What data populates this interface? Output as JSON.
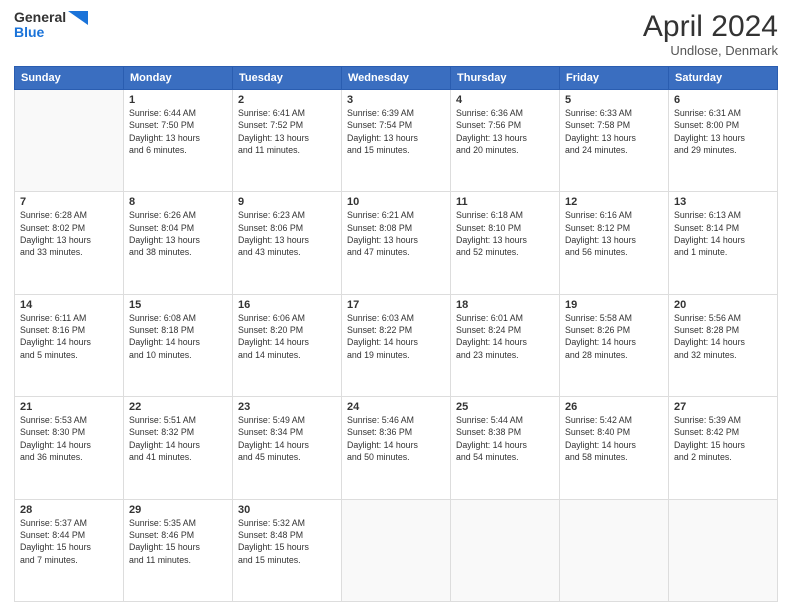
{
  "logo": {
    "line1": "General",
    "line2": "Blue"
  },
  "title": {
    "month": "April 2024",
    "location": "Undlose, Denmark"
  },
  "days_header": [
    "Sunday",
    "Monday",
    "Tuesday",
    "Wednesday",
    "Thursday",
    "Friday",
    "Saturday"
  ],
  "weeks": [
    [
      {
        "day": "",
        "info": ""
      },
      {
        "day": "1",
        "info": "Sunrise: 6:44 AM\nSunset: 7:50 PM\nDaylight: 13 hours\nand 6 minutes."
      },
      {
        "day": "2",
        "info": "Sunrise: 6:41 AM\nSunset: 7:52 PM\nDaylight: 13 hours\nand 11 minutes."
      },
      {
        "day": "3",
        "info": "Sunrise: 6:39 AM\nSunset: 7:54 PM\nDaylight: 13 hours\nand 15 minutes."
      },
      {
        "day": "4",
        "info": "Sunrise: 6:36 AM\nSunset: 7:56 PM\nDaylight: 13 hours\nand 20 minutes."
      },
      {
        "day": "5",
        "info": "Sunrise: 6:33 AM\nSunset: 7:58 PM\nDaylight: 13 hours\nand 24 minutes."
      },
      {
        "day": "6",
        "info": "Sunrise: 6:31 AM\nSunset: 8:00 PM\nDaylight: 13 hours\nand 29 minutes."
      }
    ],
    [
      {
        "day": "7",
        "info": "Sunrise: 6:28 AM\nSunset: 8:02 PM\nDaylight: 13 hours\nand 33 minutes."
      },
      {
        "day": "8",
        "info": "Sunrise: 6:26 AM\nSunset: 8:04 PM\nDaylight: 13 hours\nand 38 minutes."
      },
      {
        "day": "9",
        "info": "Sunrise: 6:23 AM\nSunset: 8:06 PM\nDaylight: 13 hours\nand 43 minutes."
      },
      {
        "day": "10",
        "info": "Sunrise: 6:21 AM\nSunset: 8:08 PM\nDaylight: 13 hours\nand 47 minutes."
      },
      {
        "day": "11",
        "info": "Sunrise: 6:18 AM\nSunset: 8:10 PM\nDaylight: 13 hours\nand 52 minutes."
      },
      {
        "day": "12",
        "info": "Sunrise: 6:16 AM\nSunset: 8:12 PM\nDaylight: 13 hours\nand 56 minutes."
      },
      {
        "day": "13",
        "info": "Sunrise: 6:13 AM\nSunset: 8:14 PM\nDaylight: 14 hours\nand 1 minute."
      }
    ],
    [
      {
        "day": "14",
        "info": "Sunrise: 6:11 AM\nSunset: 8:16 PM\nDaylight: 14 hours\nand 5 minutes."
      },
      {
        "day": "15",
        "info": "Sunrise: 6:08 AM\nSunset: 8:18 PM\nDaylight: 14 hours\nand 10 minutes."
      },
      {
        "day": "16",
        "info": "Sunrise: 6:06 AM\nSunset: 8:20 PM\nDaylight: 14 hours\nand 14 minutes."
      },
      {
        "day": "17",
        "info": "Sunrise: 6:03 AM\nSunset: 8:22 PM\nDaylight: 14 hours\nand 19 minutes."
      },
      {
        "day": "18",
        "info": "Sunrise: 6:01 AM\nSunset: 8:24 PM\nDaylight: 14 hours\nand 23 minutes."
      },
      {
        "day": "19",
        "info": "Sunrise: 5:58 AM\nSunset: 8:26 PM\nDaylight: 14 hours\nand 28 minutes."
      },
      {
        "day": "20",
        "info": "Sunrise: 5:56 AM\nSunset: 8:28 PM\nDaylight: 14 hours\nand 32 minutes."
      }
    ],
    [
      {
        "day": "21",
        "info": "Sunrise: 5:53 AM\nSunset: 8:30 PM\nDaylight: 14 hours\nand 36 minutes."
      },
      {
        "day": "22",
        "info": "Sunrise: 5:51 AM\nSunset: 8:32 PM\nDaylight: 14 hours\nand 41 minutes."
      },
      {
        "day": "23",
        "info": "Sunrise: 5:49 AM\nSunset: 8:34 PM\nDaylight: 14 hours\nand 45 minutes."
      },
      {
        "day": "24",
        "info": "Sunrise: 5:46 AM\nSunset: 8:36 PM\nDaylight: 14 hours\nand 50 minutes."
      },
      {
        "day": "25",
        "info": "Sunrise: 5:44 AM\nSunset: 8:38 PM\nDaylight: 14 hours\nand 54 minutes."
      },
      {
        "day": "26",
        "info": "Sunrise: 5:42 AM\nSunset: 8:40 PM\nDaylight: 14 hours\nand 58 minutes."
      },
      {
        "day": "27",
        "info": "Sunrise: 5:39 AM\nSunset: 8:42 PM\nDaylight: 15 hours\nand 2 minutes."
      }
    ],
    [
      {
        "day": "28",
        "info": "Sunrise: 5:37 AM\nSunset: 8:44 PM\nDaylight: 15 hours\nand 7 minutes."
      },
      {
        "day": "29",
        "info": "Sunrise: 5:35 AM\nSunset: 8:46 PM\nDaylight: 15 hours\nand 11 minutes."
      },
      {
        "day": "30",
        "info": "Sunrise: 5:32 AM\nSunset: 8:48 PM\nDaylight: 15 hours\nand 15 minutes."
      },
      {
        "day": "",
        "info": ""
      },
      {
        "day": "",
        "info": ""
      },
      {
        "day": "",
        "info": ""
      },
      {
        "day": "",
        "info": ""
      }
    ]
  ]
}
